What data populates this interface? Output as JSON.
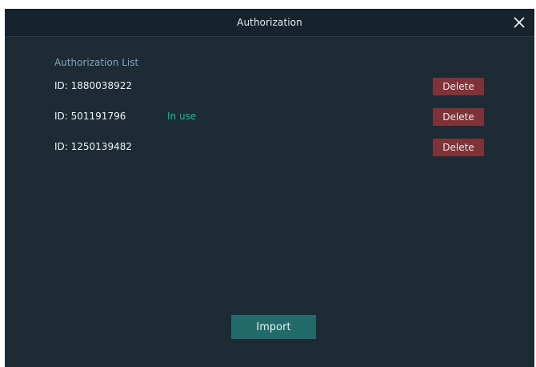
{
  "window": {
    "title": "Authorization"
  },
  "icons": {
    "close": "close-icon"
  },
  "colors": {
    "background": "#1d2b35",
    "titlebar": "#16232c",
    "heading": "#7fa7bf",
    "status_in_use": "#18b89c",
    "delete_button": "#7e3339",
    "import_button": "#236a6a"
  },
  "authorization_list": {
    "heading": "Authorization List",
    "items": [
      {
        "id": "ID: 1880038922",
        "status": "",
        "delete_label": "Delete"
      },
      {
        "id": "ID: 501191796",
        "status": "In use",
        "delete_label": "Delete"
      },
      {
        "id": "ID: 1250139482",
        "status": "",
        "delete_label": "Delete"
      }
    ]
  },
  "footer": {
    "import_label": "Import"
  }
}
